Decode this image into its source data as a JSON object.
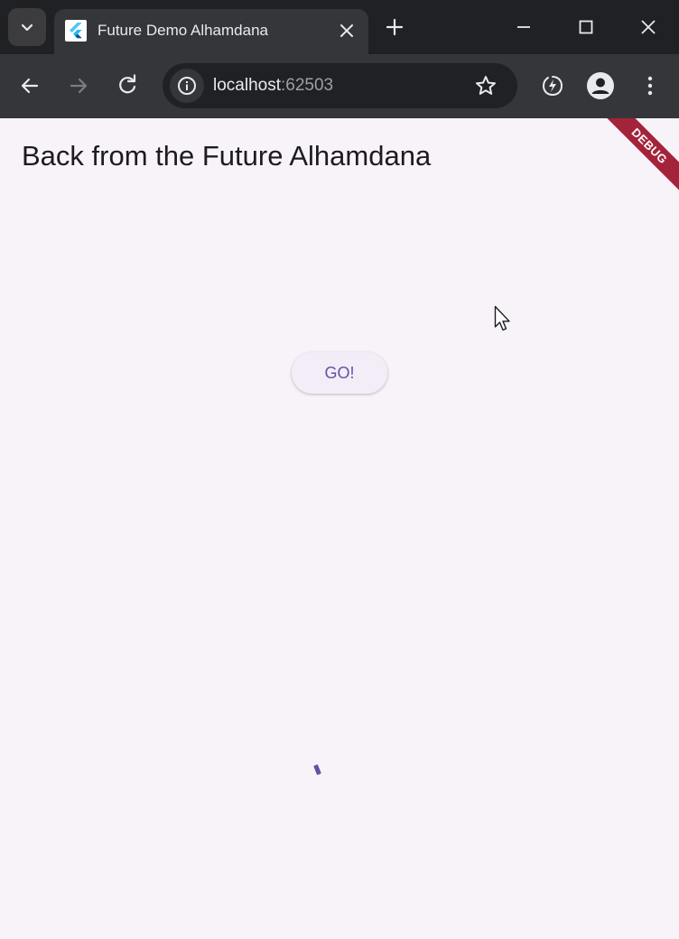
{
  "browser": {
    "tab": {
      "title": "Future Demo Alhamdana",
      "favicon": "flutter-logo-icon"
    },
    "address": {
      "host": "localhost",
      "port": ":62503"
    },
    "icons": {
      "tab_search": "chevron-down-icon",
      "tab_close": "close-icon",
      "new_tab": "plus-icon",
      "minimize": "minimize-icon",
      "maximize": "maximize-icon",
      "close_window": "close-icon",
      "back": "back-arrow-icon",
      "forward": "forward-arrow-icon",
      "reload": "reload-icon",
      "site_info": "info-icon",
      "bookmark": "star-icon",
      "extension": "performance-leaf-icon",
      "profile": "profile-avatar-icon",
      "menu": "kebab-menu-icon"
    }
  },
  "app": {
    "title": "Back from the Future Alhamdana",
    "go_button_label": "GO!",
    "debug_banner": "DEBUG",
    "accent_color": "#6750a4",
    "background_color": "#f8f3f9"
  }
}
